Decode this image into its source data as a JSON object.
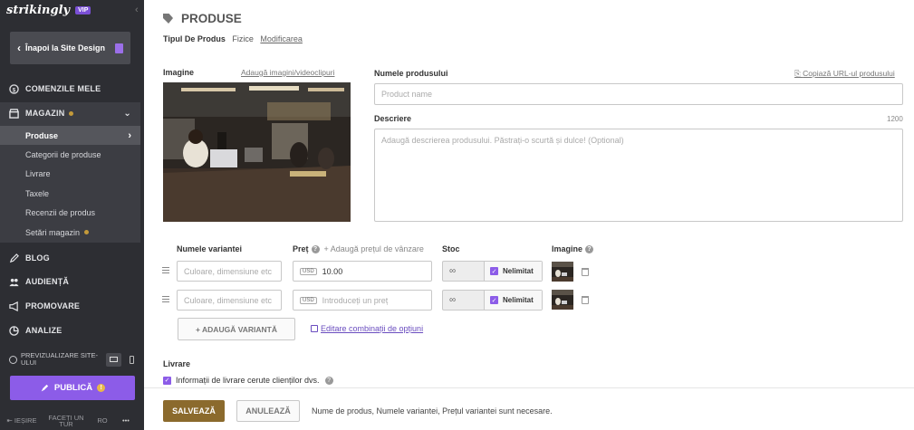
{
  "sidebar": {
    "logo": "strikingly",
    "vip_badge": "VIP",
    "back_label": "Înapoi la Site Design",
    "nav": {
      "orders": "COMENZILE MELE",
      "store": "MAGAZIN",
      "blog": "BLOG",
      "audience": "AUDIENȚĂ",
      "promotion": "PROMOVARE",
      "analytics": "ANALIZE"
    },
    "store_sub": [
      "Produse",
      "Categorii de produse",
      "Livrare",
      "Taxele",
      "Recenzii de produs",
      "Setări magazin"
    ],
    "preview_label": "PREVIZUALIZARE SITE-ULUI",
    "publish_label": "PUBLICĂ",
    "publish_warn": "!",
    "footer": {
      "exit": "IEȘIRE",
      "tour": "FACEȚI UN TUR",
      "lang": "RO",
      "more": "•••"
    }
  },
  "main": {
    "title": "PRODUSE",
    "product_type_label": "Tipul De Produs",
    "product_type_value": "Fizice",
    "modify_link": "Modificarea",
    "image_label": "Imagine",
    "add_images_link": "Adaugă imagini/videoclipuri",
    "product_name_label": "Numele produsului",
    "copy_url_link": "Copiază URL-ul produsului",
    "product_name_placeholder": "Product name",
    "description_label": "Descriere",
    "description_count": "1200",
    "description_placeholder": "Adaugă descrierea produsului. Păstrați-o scurtă și dulce! (Optional)",
    "variants": {
      "col_name": "Numele variantei",
      "col_price": "Preț",
      "add_sale_price": "+ Adaugă prețul de vânzare",
      "col_stock": "Stoc",
      "col_image": "Imagine",
      "rows": [
        {
          "name_placeholder": "Culoare, dimensiune etc",
          "currency": "USD",
          "price": "10.00",
          "stock": "∞",
          "unlimited": "Nelimitat"
        },
        {
          "name_placeholder": "Culoare, dimensiune etc",
          "currency": "USD",
          "price_placeholder": "Introduceți un preț",
          "stock": "∞",
          "unlimited": "Nelimitat"
        }
      ],
      "add_variant_label": "+ ADAUGĂ VARIANTĂ",
      "edit_combos_link": "Editare combinații de opțiuni"
    },
    "shipping_label": "Livrare",
    "shipping_checkbox": "Informații de livrare cerute clienților dvs."
  },
  "bottom": {
    "save_label": "SALVEAZĂ",
    "cancel_label": "ANULEAZĂ",
    "message": "Nume de produs, Numele variantei, Prețul variantei sunt necesare."
  },
  "colors": {
    "sidebar_bg": "#2d2e33",
    "accent_purple": "#8c5ce8",
    "save_gold": "#8b6a2d",
    "dot_gold": "#c49a3a"
  }
}
